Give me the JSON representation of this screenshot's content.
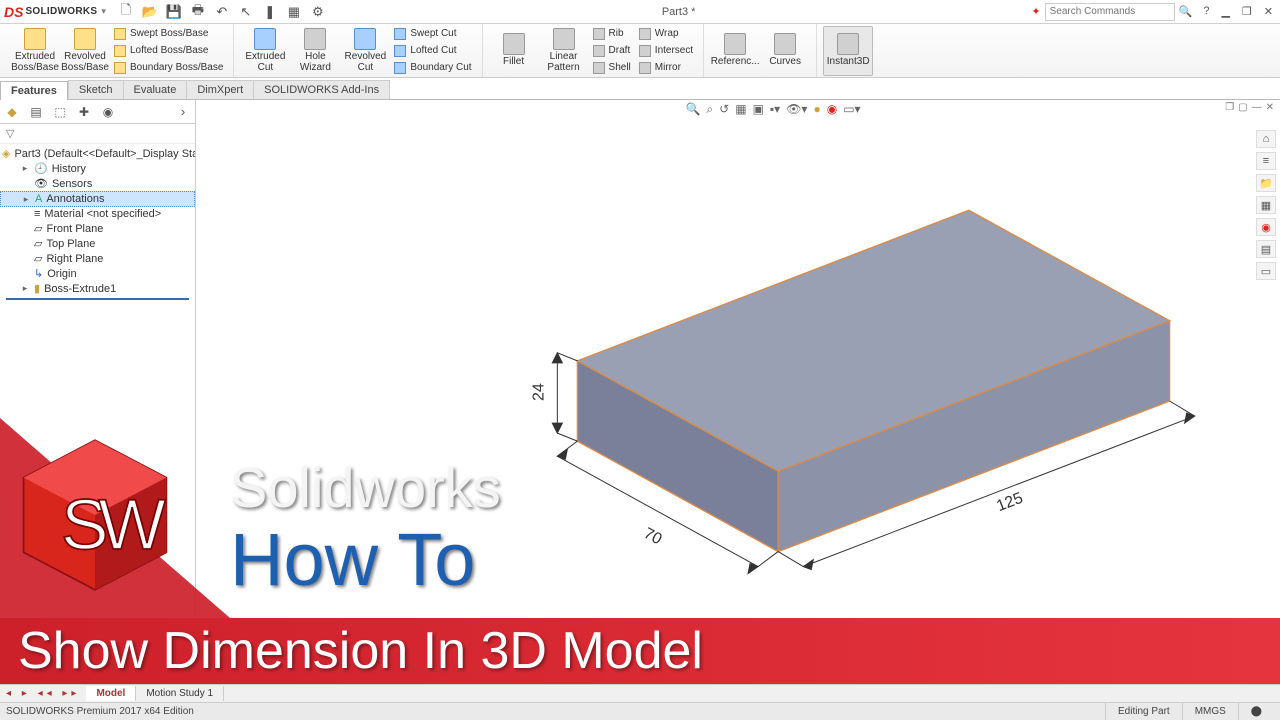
{
  "app": {
    "name": "SOLIDWORKS",
    "doc_title": "Part3 *"
  },
  "search": {
    "placeholder": "Search Commands"
  },
  "qat": [
    "new",
    "open",
    "save",
    "print",
    "undo",
    "select",
    "rebuild",
    "options",
    "settings"
  ],
  "ribbon": {
    "extruded_boss": "Extruded Boss/Base",
    "revolved_boss": "Revolved Boss/Base",
    "swept_boss": "Swept Boss/Base",
    "lofted_boss": "Lofted Boss/Base",
    "boundary_boss": "Boundary Boss/Base",
    "extruded_cut": "Extruded Cut",
    "hole_wizard": "Hole Wizard",
    "revolved_cut": "Revolved Cut",
    "swept_cut": "Swept Cut",
    "lofted_cut": "Lofted Cut",
    "boundary_cut": "Boundary Cut",
    "fillet": "Fillet",
    "linear_pattern": "Linear Pattern",
    "rib": "Rib",
    "draft": "Draft",
    "shell": "Shell",
    "wrap": "Wrap",
    "intersect": "Intersect",
    "mirror": "Mirror",
    "ref_geom": "Referenc...",
    "curves": "Curves",
    "instant3d": "Instant3D"
  },
  "tabs": [
    "Features",
    "Sketch",
    "Evaluate",
    "DimXpert",
    "SOLIDWORKS Add-Ins"
  ],
  "tree": {
    "root": "Part3  (Default<<Default>_Display Sta",
    "history": "History",
    "sensors": "Sensors",
    "annotations": "Annotations",
    "material": "Material <not specified>",
    "front": "Front Plane",
    "top": "Top Plane",
    "right": "Right Plane",
    "origin": "Origin",
    "boss": "Boss-Extrude1"
  },
  "dimensions": {
    "length": "125",
    "width": "70",
    "height": "24"
  },
  "bottom_tabs": {
    "model": "Model",
    "motion": "Motion Study 1"
  },
  "status": {
    "edition": "SOLIDWORKS Premium 2017 x64 Edition",
    "mode": "Editing Part",
    "units": "MMGS"
  },
  "overlay": {
    "brand": "Solidworks",
    "howto": "How To",
    "banner": "Show Dimension In 3D Model"
  }
}
